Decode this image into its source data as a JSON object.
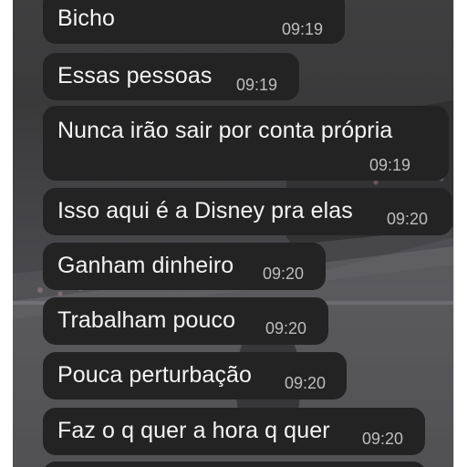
{
  "messages": [
    {
      "text": "Bicho",
      "time": "09:19"
    },
    {
      "text": "Essas pessoas",
      "time": "09:19"
    },
    {
      "text": "Nunca irão sair por conta própria",
      "time": "09:19"
    },
    {
      "text": "Isso aqui é a Disney pra elas",
      "time": "09:20"
    },
    {
      "text": "Ganham dinheiro",
      "time": "09:20"
    },
    {
      "text": "Trabalham pouco",
      "time": "09:20"
    },
    {
      "text": "Pouca perturbação",
      "time": "09:20"
    },
    {
      "text": "Faz o q quer a hora q quer",
      "time": "09:20"
    }
  ]
}
